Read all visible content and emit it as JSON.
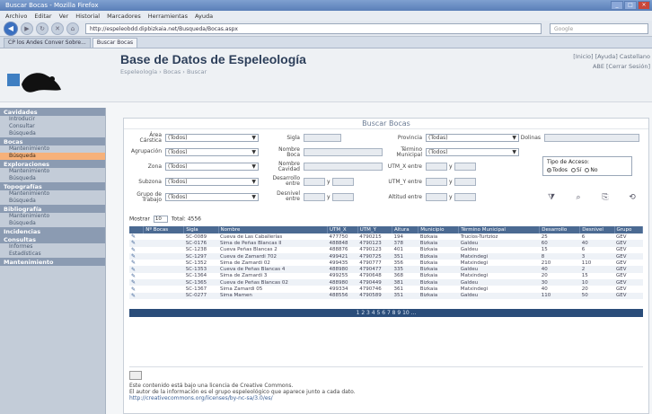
{
  "browser": {
    "title": "Buscar Bocas - Mozilla Firefox",
    "menu": [
      "Archivo",
      "Editar",
      "Ver",
      "Historial",
      "Marcadores",
      "Herramientas",
      "Ayuda"
    ],
    "url": "http://espeleobdd.dipbizkaia.net/Busqueda/Bocas.aspx",
    "search_placeholder": "Google",
    "tabs": [
      "CP los Andes Conver Sobre...",
      "Buscar Bocas"
    ]
  },
  "header": {
    "title": "Base de Datos de Espeleología",
    "breadcrumb": "Espeleología › Bocas › Buscar",
    "right_links": "[Inicio]  [Ayuda]  Castellano",
    "user": "ABE [Cerrar Sesión]"
  },
  "sidebar": [
    {
      "section": "Cavidades",
      "items": [
        "Introducir",
        "Consultar",
        "Búsqueda"
      ]
    },
    {
      "section": "Bocas",
      "items": [
        "Mantenimiento",
        "Búsqueda"
      ],
      "active": 1
    },
    {
      "section": "Exploraciones",
      "items": [
        "Mantenimiento",
        "Búsqueda"
      ]
    },
    {
      "section": "Topografías",
      "items": [
        "Mantenimiento",
        "Búsqueda"
      ]
    },
    {
      "section": "Bibliografía",
      "items": [
        "Mantenimiento",
        "Búsqueda"
      ]
    },
    {
      "section": "Incidencias",
      "items": []
    },
    {
      "section": "Consultas",
      "items": [
        "Informes",
        "Estadísticas"
      ]
    },
    {
      "section": "Mantenimiento",
      "items": []
    }
  ],
  "panel": {
    "title": "Buscar Bocas",
    "labels": {
      "area": "Área Cárstica",
      "agrupacion": "Agrupación",
      "zona": "Zona",
      "subzona": "Subzona",
      "grupo": "Grupo de Trabajo",
      "sigla": "Sigla",
      "nombre_boca": "Nombre Boca",
      "nombre_cavidad": "Nombre Cavidad",
      "desarrollo": "Desarrollo entre",
      "desnivel": "Desnivel entre",
      "provincia": "Provincia",
      "termino": "Término Municipal",
      "utm_x": "UTM_X entre",
      "utm_y": "UTM_Y entre",
      "altitud": "Altitud entre",
      "dolinas": "Dolinas",
      "tipo_acceso": "Tipo de Acceso:",
      "todos": "Todos",
      "si": "Sí",
      "no": "No",
      "y": "y"
    },
    "select_value": "(Todos)",
    "provincia_value": "(Todas)",
    "show_label": "Mostrar",
    "show_value": "10",
    "total_text": "Total: 4556"
  },
  "table": {
    "headers": [
      "",
      "Nº Bocas",
      "Sigla",
      "Nombre",
      "UTM_X",
      "UTM_Y",
      "Altura",
      "Municipio",
      "Término Municipal",
      "Desarrollo",
      "Desnivel",
      "Grupo"
    ],
    "rows": [
      [
        "",
        "",
        "SC-0089",
        "Cueva de Las Caballerías",
        "477750",
        "4790215",
        "194",
        "Bizkaia",
        "Trucíos-Turtzioz",
        "25",
        "6",
        "GEV"
      ],
      [
        "",
        "",
        "SC-0176",
        "Sima de Peñas Blancas II",
        "488848",
        "4790123",
        "378",
        "Bizkaia",
        "Galdeu",
        "60",
        "40",
        "GEV"
      ],
      [
        "",
        "",
        "SC-1238",
        "Cueva Peñas Blancas 2",
        "488876",
        "4790123",
        "401",
        "Bizkaia",
        "Galdeu",
        "15",
        "6",
        "GEV"
      ],
      [
        "",
        "",
        "SC-1297",
        "Cueva de Zamardi 702",
        "499421",
        "4790725",
        "351",
        "Bizkaia",
        "Matxindegi",
        "8",
        "3",
        "GEV"
      ],
      [
        "",
        "",
        "SC-1352",
        "Sima de Zamardi 02",
        "499435",
        "4790777",
        "356",
        "Bizkaia",
        "Matxindegi",
        "210",
        "110",
        "GEV"
      ],
      [
        "",
        "",
        "SC-1353",
        "Cueva de Peñas Blancas 4",
        "488980",
        "4790477",
        "335",
        "Bizkaia",
        "Galdeu",
        "40",
        "2",
        "GEV"
      ],
      [
        "",
        "",
        "SC-1364",
        "Sima de Zamardi 3",
        "499255",
        "4790648",
        "368",
        "Bizkaia",
        "Matxindegi",
        "20",
        "15",
        "GEV"
      ],
      [
        "",
        "",
        "SC-1365",
        "Cueva de Peñas Blancas 02",
        "488980",
        "4790449",
        "381",
        "Bizkaia",
        "Galdeu",
        "30",
        "10",
        "GEV"
      ],
      [
        "",
        "",
        "SC-1367",
        "Sima Zamardi 05",
        "499334",
        "4790746",
        "361",
        "Bizkaia",
        "Matxindegi",
        "40",
        "20",
        "GEV"
      ],
      [
        "",
        "",
        "SC-0277",
        "Sima Mamen",
        "488556",
        "4790589",
        "351",
        "Bizkaia",
        "Galdeu",
        "110",
        "50",
        "GEV"
      ]
    ],
    "pager": "1 2 3 4 5 6 7 8 9 10 ..."
  },
  "footer": {
    "line1": "Este contenido está bajo una licencia de Creative Commons.",
    "line2": "El autor de la información es el grupo espeleológico que aparece junto a cada dato.",
    "link": "http://creativecommons.org/licenses/by-nc-sa/3.0/es/"
  }
}
